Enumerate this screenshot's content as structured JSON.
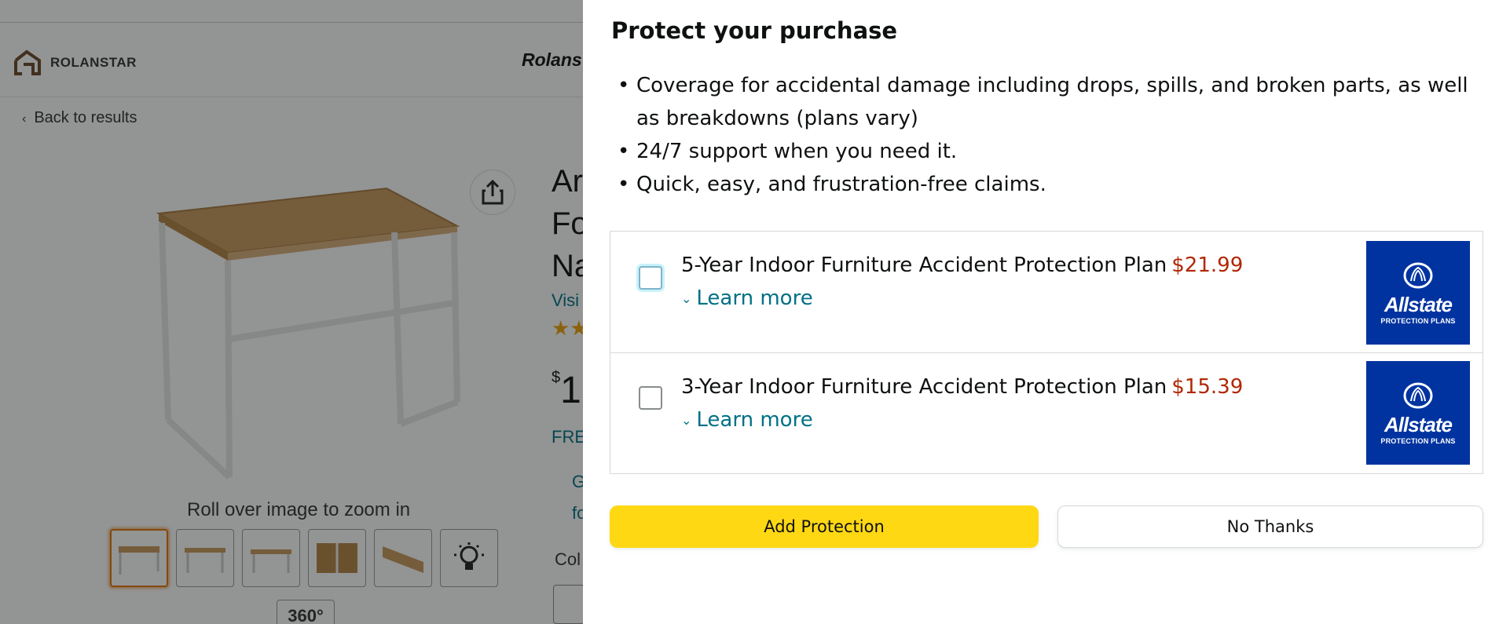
{
  "background": {
    "brand_name": "ROLANSTAR",
    "brand_title": "Rolans",
    "back_link": "Back to results",
    "zoom_hint": "Roll over image to zoom in",
    "view360_label": "360°",
    "title_lines": [
      "Ar",
      "Fo",
      "Na"
    ],
    "visit_link": "Visi",
    "price_symbol": "$",
    "price_whole": "1",
    "free_delivery": "FRE",
    "gift_lines": [
      "G",
      "fo"
    ],
    "color_label": "Col"
  },
  "panel": {
    "title": "Protect your purchase",
    "benefits": [
      "Coverage for accidental damage including drops, spills, and broken parts, as well as breakdowns (plans vary)",
      "24/7 support when you need it.",
      "Quick, easy, and frustration-free claims."
    ],
    "plans": [
      {
        "name": "5-Year Indoor Furniture Accident Protection Plan",
        "price": "$21.99",
        "learn_more": "Learn more",
        "checked": false,
        "logo_name": "Allstate",
        "logo_sub": "PROTECTION PLANS"
      },
      {
        "name": "3-Year Indoor Furniture Accident Protection Plan",
        "price": "$15.39",
        "learn_more": "Learn more",
        "checked": false,
        "logo_name": "Allstate",
        "logo_sub": "PROTECTION PLANS"
      }
    ],
    "add_button": "Add Protection",
    "no_button": "No Thanks"
  },
  "colors": {
    "price_red": "#b12704",
    "link_teal": "#007185",
    "button_yellow": "#ffd814",
    "allstate_blue": "#0033a0"
  }
}
